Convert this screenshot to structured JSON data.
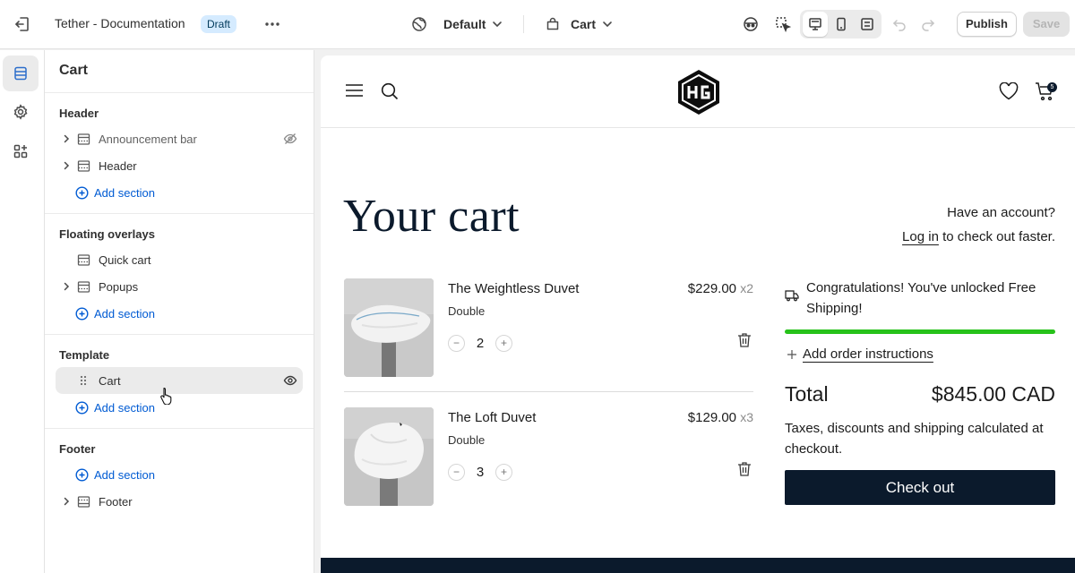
{
  "topbar": {
    "store_title": "Tether - Documentation",
    "status_badge": "Draft",
    "theme_label": "Default",
    "page_label": "Cart",
    "publish_label": "Publish",
    "save_label": "Save"
  },
  "rail": {
    "items": [
      {
        "icon": "sections-icon",
        "active": true
      },
      {
        "icon": "settings-icon",
        "active": false
      },
      {
        "icon": "apps-icon",
        "active": false
      }
    ]
  },
  "sidebar": {
    "title": "Cart",
    "groups": {
      "header": {
        "label": "Header",
        "items": [
          "Announcement bar",
          "Header"
        ],
        "add": "Add section"
      },
      "overlays": {
        "label": "Floating overlays",
        "items": [
          "Quick cart",
          "Popups"
        ],
        "add": "Add section"
      },
      "template": {
        "label": "Template",
        "items": [
          "Cart"
        ],
        "add": "Add section"
      },
      "footer": {
        "label": "Footer",
        "add": "Add section",
        "items": [
          "Footer"
        ]
      }
    }
  },
  "preview": {
    "cart_count": "5",
    "page_title": "Your cart",
    "account_prompt": "Have an account?",
    "login_link": "Log in",
    "login_suffix": "to check out faster.",
    "items": [
      {
        "name": "The Weightless Duvet",
        "variant": "Double",
        "price": "$229.00",
        "qty_mult": "x2",
        "qty": "2"
      },
      {
        "name": "The Loft Duvet",
        "variant": "Double",
        "price": "$129.00",
        "qty_mult": "x3",
        "qty": "3"
      }
    ],
    "shipping_message": "Congratulations! You've unlocked Free Shipping!",
    "shipping_progress": 1.0,
    "order_instructions": "Add order instructions",
    "total_label": "Total",
    "total_value": "$845.00 CAD",
    "tax_note": "Taxes, discounts and shipping calculated at checkout.",
    "checkout_label": "Check out"
  },
  "colors": {
    "accent_link": "#005bd3",
    "progress": "#27c21a",
    "brand_dark": "#0b1a2c",
    "draft_badge": "#d5ebff"
  }
}
